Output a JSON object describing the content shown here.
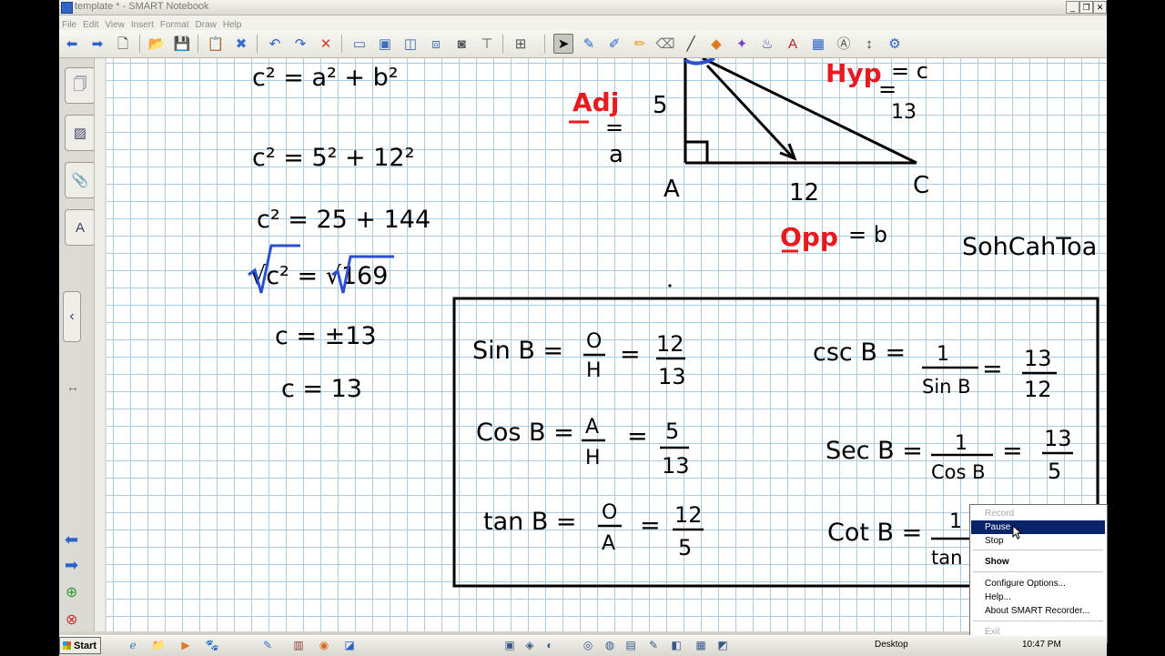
{
  "window": {
    "title": "template * - SMART Notebook",
    "min_glyph": "_",
    "max_glyph": "❐",
    "close_glyph": "✕"
  },
  "menu": [
    "File",
    "Edit",
    "View",
    "Insert",
    "Format",
    "Draw",
    "Help"
  ],
  "toolbar": {
    "icons": [
      {
        "name": "back-arrow-icon",
        "glyph": "⬅",
        "color": "#2a63c8"
      },
      {
        "name": "forward-arrow-icon",
        "glyph": "➡",
        "color": "#2a63c8"
      },
      {
        "name": "add-page-icon",
        "glyph": "🗋",
        "color": "#333333"
      },
      {
        "name": "open-folder-icon",
        "glyph": "📂",
        "color": "#d9a520"
      },
      {
        "name": "save-icon",
        "glyph": "💾",
        "color": "#2a4fa0"
      },
      {
        "name": "paste-icon",
        "glyph": "📋",
        "color": "#8a6a2a"
      },
      {
        "name": "delete-icon",
        "glyph": "✖",
        "color": "#3a6fc8"
      },
      {
        "name": "undo-icon",
        "glyph": "↶",
        "color": "#2a63c8"
      },
      {
        "name": "redo-icon",
        "glyph": "↷",
        "color": "#2a63c8"
      },
      {
        "name": "clear-icon",
        "glyph": "✕",
        "color": "#d63b2a"
      },
      {
        "name": "full-screen-icon",
        "glyph": "▭",
        "color": "#3f6fb5"
      },
      {
        "name": "screen-shade-icon",
        "glyph": "▣",
        "color": "#3f6fb5"
      },
      {
        "name": "dual-screen-icon",
        "glyph": "◫",
        "color": "#3f6fb5"
      },
      {
        "name": "capture-icon",
        "glyph": "⧈",
        "color": "#3f6fb5"
      },
      {
        "name": "camera-icon",
        "glyph": "◙",
        "color": "#555555"
      },
      {
        "name": "document-camera-icon",
        "glyph": "⊤",
        "color": "#555555"
      },
      {
        "name": "table-icon",
        "glyph": "⊞",
        "color": "#555555"
      },
      {
        "name": "select-pointer-icon",
        "glyph": "➤",
        "color": "#000000"
      },
      {
        "name": "pen-icon",
        "glyph": "✎",
        "color": "#2a63c8"
      },
      {
        "name": "creative-pen-icon",
        "glyph": "✐",
        "color": "#2a63c8"
      },
      {
        "name": "highlighter-icon",
        "glyph": "✏",
        "color": "#e0a020"
      },
      {
        "name": "eraser-icon",
        "glyph": "⌫",
        "color": "#777777"
      },
      {
        "name": "line-icon",
        "glyph": "╱",
        "color": "#333333"
      },
      {
        "name": "shapes-icon",
        "glyph": "◆",
        "color": "#e07a20"
      },
      {
        "name": "magic-pen-icon",
        "glyph": "✦",
        "color": "#7a40c0"
      },
      {
        "name": "fill-icon",
        "glyph": "♨",
        "color": "#3a3a9a"
      },
      {
        "name": "text-icon",
        "glyph": "A",
        "color": "#c02020"
      },
      {
        "name": "properties-icon",
        "glyph": "▦",
        "color": "#2a63c8"
      },
      {
        "name": "recognize-icon",
        "glyph": "Ⓐ",
        "color": "#555555"
      },
      {
        "name": "move-toolbar-icon",
        "glyph": "↕",
        "color": "#333333"
      },
      {
        "name": "customize-icon",
        "glyph": "⚙",
        "color": "#2a63c8"
      }
    ]
  },
  "sidepanel": {
    "tabs": [
      {
        "name": "page-sorter-icon",
        "glyph": "🗍"
      },
      {
        "name": "gallery-icon",
        "glyph": "▨"
      },
      {
        "name": "attachments-icon",
        "glyph": "📎"
      },
      {
        "name": "properties-tab-icon",
        "glyph": "A"
      }
    ],
    "collapse_glyph": "‹",
    "resize_glyph": "↔",
    "prev_page_glyph": "⬅",
    "next_page_glyph": "➡",
    "add_page_glyph": "⊕",
    "delete_page_glyph": "⊗"
  },
  "canvas": {
    "pythagoras": [
      "c² = a² + b²",
      "c² = 5² + 12²",
      "c² = 25 + 144",
      "√c² = √169",
      "c = ±13",
      "c = 13"
    ],
    "triangle": {
      "adj_label": "Adj",
      "adj_eq": "=",
      "adj_var": "a",
      "hyp_label": "Hyp",
      "hyp_eq": "= c",
      "hyp_eq2": "=",
      "hyp_val": "13",
      "opp_label": "Opp",
      "opp_eq": "= b",
      "side_ab": "5",
      "side_ac": "12",
      "vertex_a": "A",
      "vertex_c": "C"
    },
    "mnemonic": "SohCahToa",
    "trig_box": {
      "sin_label": "Sin B =",
      "sin_num": "O",
      "sin_den": "H",
      "sin_eq": "=",
      "sin_vnum": "12",
      "sin_vden": "13",
      "cos_label": "Cos B =",
      "cos_num": "A",
      "cos_den": "H",
      "cos_eq": "=",
      "cos_vnum": "5",
      "cos_vden": "13",
      "tan_label": "tan B =",
      "tan_num": "O",
      "tan_den": "A",
      "tan_eq": "=",
      "tan_vnum": "12",
      "tan_vden": "5",
      "csc_label": "csc B =",
      "csc_num": "1",
      "csc_den": "Sin B",
      "csc_eq": "=",
      "csc_vnum": "13",
      "csc_vden": "12",
      "sec_label": "Sec B =",
      "sec_num": "1",
      "sec_den": "Cos B",
      "sec_eq": "=",
      "sec_vnum": "13",
      "sec_vden": "5",
      "cot_label": "Cot B =",
      "cot_num": "1",
      "cot_den": "tan B",
      "cot_eq": "="
    },
    "colors": {
      "ink": "#000000",
      "red": "#e8191f",
      "blue": "#2a4fd0",
      "grid": "#a9cde8"
    }
  },
  "recorder_menu": {
    "record": "Record",
    "pause": "Pause",
    "stop": "Stop",
    "show": "Show",
    "configure": "Configure Options...",
    "help": "Help...",
    "about": "About SMART Recorder...",
    "exit": "Exit"
  },
  "taskbar": {
    "start": "Start",
    "apps": [
      {
        "name": "internet-explorer-icon",
        "glyph": "ℯ",
        "color": "#2a7ad0"
      },
      {
        "name": "explorer-icon",
        "glyph": "📁",
        "color": "#d9a520"
      },
      {
        "name": "media-player-icon",
        "glyph": "▶",
        "color": "#e07a20"
      },
      {
        "name": "gimp-icon",
        "glyph": "🐾",
        "color": "#7a6a40"
      },
      {
        "name": "paint-icon",
        "glyph": "✎",
        "color": "#3a70c0"
      },
      {
        "name": "library-icon",
        "glyph": "▥",
        "color": "#8a3a3a"
      },
      {
        "name": "firefox-icon",
        "glyph": "◉",
        "color": "#e06a20"
      },
      {
        "name": "notebook-icon",
        "glyph": "◪",
        "color": "#2a63c8"
      }
    ],
    "tray": [
      {
        "name": "tray-monitor-icon",
        "glyph": "▣"
      },
      {
        "name": "tray-network-icon",
        "glyph": "◈"
      },
      {
        "name": "tray-volume-icon",
        "glyph": "◐"
      },
      {
        "name": "tray-chrome-icon",
        "glyph": "◎"
      },
      {
        "name": "tray-security-icon",
        "glyph": "◍"
      },
      {
        "name": "tray-app-icon",
        "glyph": "▤"
      },
      {
        "name": "tray-paint-icon",
        "glyph": "✎"
      },
      {
        "name": "tray-app2-icon",
        "glyph": "◧"
      },
      {
        "name": "tray-app3-icon",
        "glyph": "▦"
      },
      {
        "name": "tray-app4-icon",
        "glyph": "◩"
      }
    ],
    "desktop": "Desktop",
    "clock": "10:47 PM"
  }
}
